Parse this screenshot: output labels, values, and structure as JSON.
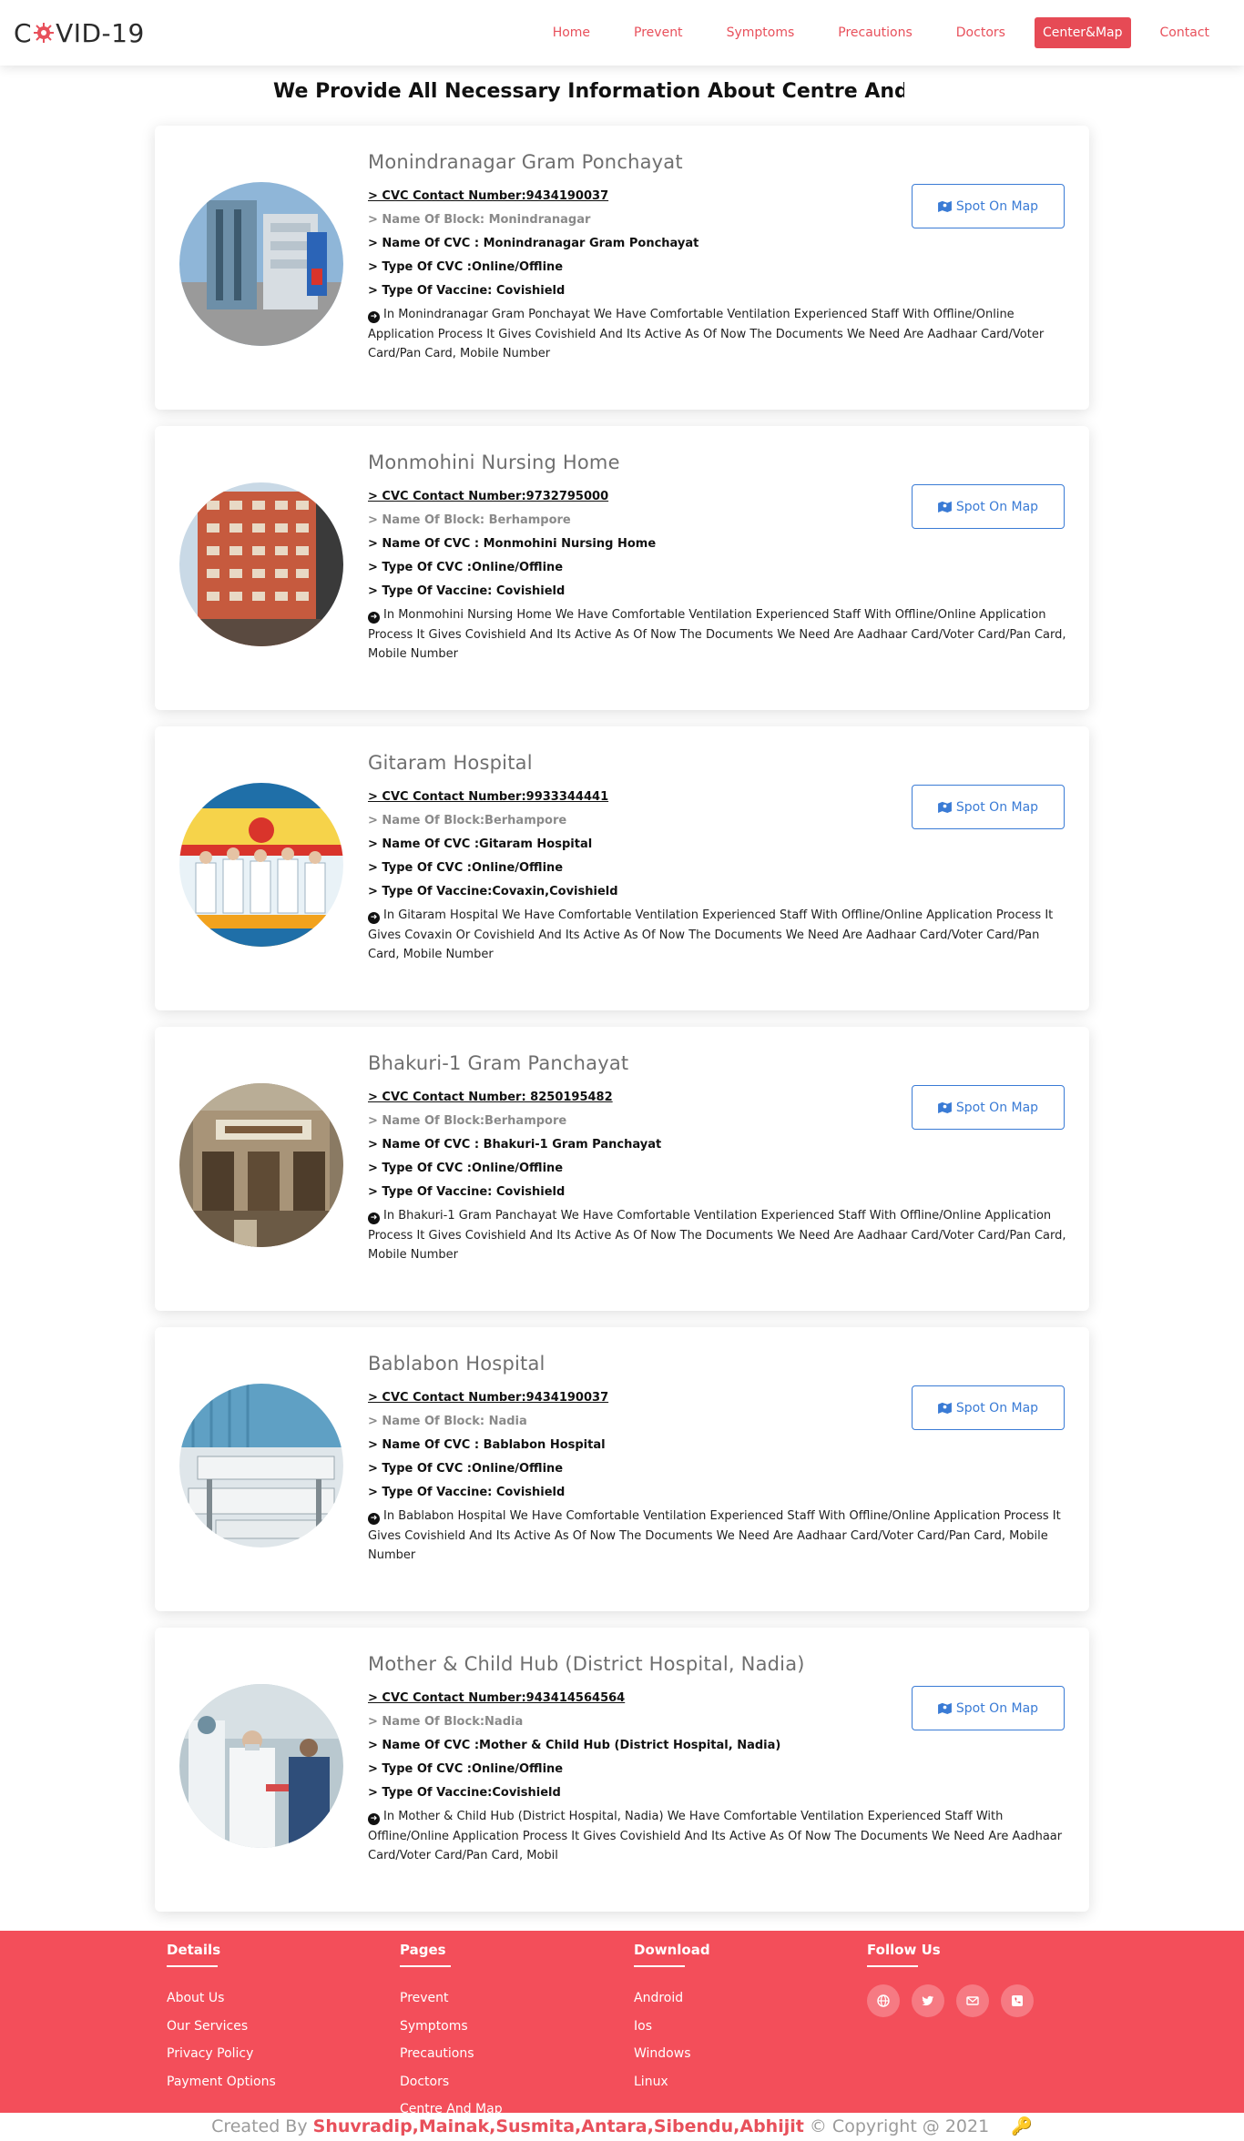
{
  "nav": {
    "brand_prefix": "C",
    "brand_suffix": "VID-19",
    "links": [
      "Home",
      "Prevent",
      "Symptoms",
      "Precautions",
      "Doctors",
      "Center&Map",
      "Contact"
    ],
    "active": "Center&Map"
  },
  "heading": "We Provide All Necessary Information About Centre And Map",
  "map_button_label": "Spot On Map",
  "cards": [
    {
      "title": "Monindranagar Gram Ponchayat",
      "contact": "> CVC Contact Number:9434190037",
      "block": "> Name Of Block: Monindranagar",
      "cvc_name": "> Name Of CVC : Monindranagar Gram Ponchayat",
      "cvc_type": "> Type Of CVC :Online/Offline",
      "vaccine": "> Type Of Vaccine: Covishield",
      "description": "In Monindranagar Gram Ponchayat We Have Comfortable Ventilation Experienced Staff With Offline/Online Application Process It Gives Covishield And Its Active As Of Now The Documents We Need Are Aadhaar Card/Voter Card/Pan Card, Mobile Number",
      "photo": "hospital-building"
    },
    {
      "title": "Monmohini Nursing Home",
      "contact": "> CVC Contact Number:9732795000",
      "block": "> Name Of Block: Berhampore",
      "cvc_name": "> Name Of CVC : Monmohini Nursing Home",
      "cvc_type": "> Type Of CVC :Online/Offline",
      "vaccine": "> Type Of Vaccine: Covishield",
      "description": "In Monmohini Nursing Home We Have Comfortable Ventilation Experienced Staff With Offline/Online Application Process It Gives Covishield And Its Active As Of Now The Documents We Need Are Aadhaar Card/Voter Card/Pan Card, Mobile Number",
      "photo": "apartment-building"
    },
    {
      "title": "Gitaram Hospital",
      "contact": "> CVC Contact Number:9933344441",
      "block": "> Name Of Block:Berhampore",
      "cvc_name": "> Name Of CVC :Gitaram Hospital",
      "cvc_type": "> Type Of CVC :Online/Offline",
      "vaccine": "> Type Of Vaccine:Covaxin,Covishield",
      "description": "In Gitaram Hospital We Have Comfortable Ventilation Experienced Staff With Offline/Online Application Process It Gives Covaxin Or Covishield And Its Active As Of Now The Documents We Need Are Aadhaar Card/Voter Card/Pan Card, Mobile Number",
      "photo": "hospital-poster"
    },
    {
      "title": "Bhakuri-1 Gram Panchayat",
      "contact": "> CVC Contact Number: 8250195482",
      "block": "> Name Of Block:Berhampore",
      "cvc_name": "> Name Of CVC : Bhakuri-1 Gram Panchayat",
      "cvc_type": "> Type Of CVC :Online/Offline",
      "vaccine": "> Type Of Vaccine: Covishield",
      "description": "In Bhakuri-1 Gram Panchayat We Have Comfortable Ventilation Experienced Staff With Offline/Online Application Process It Gives Covishield And Its Active As Of Now The Documents We Need Are Aadhaar Card/Voter Card/Pan Card, Mobile Number",
      "photo": "panchayat-office"
    },
    {
      "title": "Bablabon Hospital",
      "contact": "> CVC Contact Number:9434190037",
      "block": "> Name Of Block: Nadia",
      "cvc_name": "> Name Of CVC : Bablabon Hospital",
      "cvc_type": "> Type Of CVC :Online/Offline",
      "vaccine": "> Type Of Vaccine: Covishield",
      "description": "In Bablabon Hospital We Have Comfortable Ventilation Experienced Staff With Offline/Online Application Process It Gives Covishield And Its Active As Of Now The Documents We Need Are Aadhaar Card/Voter Card/Pan Card, Mobile Number",
      "photo": "hospital-ward"
    },
    {
      "title": "Mother & Child Hub (District Hospital, Nadia)",
      "contact": "> CVC Contact Number:943414564564",
      "block": "> Name Of Block:Nadia",
      "cvc_name": "> Name Of CVC :Mother & Child Hub (District Hospital, Nadia)",
      "cvc_type": "> Type Of CVC :Online/Offline",
      "vaccine": "> Type Of Vaccine:Covishield",
      "description": "In Mother & Child Hub (District Hospital, Nadia) We Have Comfortable Ventilation Experienced Staff With Offline/Online Application Process It Gives Covishield And Its Active As Of Now The Documents We Need Are Aadhaar Card/Voter Card/Pan Card, Mobil",
      "photo": "medical-staff"
    }
  ],
  "footer": {
    "details": {
      "title": "Details",
      "links": [
        "About Us",
        "Our Services",
        "Privacy Policy",
        "Payment Options"
      ]
    },
    "pages": {
      "title": "Pages",
      "links": [
        "Prevent",
        "Symptoms",
        "Precautions",
        "Doctors",
        "Centre And Map"
      ]
    },
    "download": {
      "title": "Download",
      "links": [
        "Android",
        "Ios",
        "Windows",
        "Linux"
      ]
    },
    "follow": {
      "title": "Follow Us",
      "icons": [
        "globe-icon",
        "twitter-icon",
        "mail-icon",
        "phone-icon"
      ]
    }
  },
  "credits": {
    "prefix": "Created By",
    "names": "Shuvradip,Mainak,Susmita,Antara,Sibendu,Abhijit",
    "copyright": "© Copyright @ 2021",
    "icon": "key-icon"
  },
  "colors": {
    "accent": "#e8505b",
    "footer": "#f34e5a",
    "button": "#3a7bd5"
  }
}
